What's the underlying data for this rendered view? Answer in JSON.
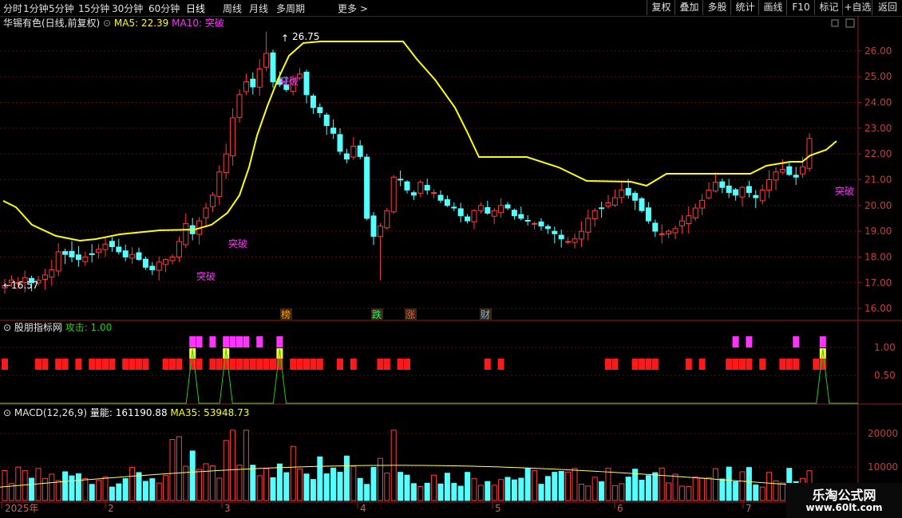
{
  "toolbar": {
    "left": [
      "分时",
      "1分钟",
      "5分钟",
      "15分钟",
      "30分钟",
      "60分钟",
      "日线",
      "周线",
      "月线",
      "多周期",
      "更多"
    ],
    "active": "日线",
    "right": [
      "复权",
      "叠加",
      "多股",
      "统计",
      "画线",
      "F10",
      "标记",
      "+自选",
      "返回"
    ]
  },
  "main_header": {
    "stock": "华锡有色(日线,前复权)",
    "ma5": "MA5: 22.39",
    "ma10": "MA10: 突破"
  },
  "ind_header": {
    "name": "股朋指标网",
    "attack": "攻击: 1.00"
  },
  "vol_header": {
    "name": "MACD(12,26,9)",
    "vol": "量能: 161190.88",
    "ma35": "MA35: 53948.73"
  },
  "price_axis_labels": [
    "26.00",
    "25.00",
    "24.00",
    "23.00",
    "22.00",
    "21.00",
    "20.00",
    "19.00",
    "18.00",
    "17.00",
    "16.00"
  ],
  "ind_axis_labels": [
    "1.00",
    "0.50"
  ],
  "vol_axis_labels": [
    "20000",
    "10000"
  ],
  "date_labels": [
    "2025年",
    "2",
    "3",
    "4",
    "5",
    "6",
    "7"
  ],
  "annotations": {
    "high": "26.75",
    "low": "16.57",
    "breakout": "突破",
    "events": [
      "榜",
      "跌",
      "涨",
      "财"
    ]
  },
  "watermark": {
    "line1": "乐淘公式网",
    "line2": "www.60lt.com"
  },
  "colors": {
    "up": "#ff3c3c",
    "down": "#54ffff",
    "ma": "#ffff00",
    "magenta": "#ff33ff",
    "green": "#22cc22"
  },
  "chart_data": {
    "type": "candlestick",
    "ylim": [
      15.6,
      26.8
    ],
    "close_seed": [
      16.9,
      17.1,
      17.0,
      17.2,
      17.0,
      17.1,
      17.3,
      17.5,
      18.2,
      18.1,
      18.0,
      17.9,
      18.0,
      18.1,
      18.3,
      18.5,
      18.4,
      18.2,
      18.0,
      18.1,
      17.9,
      17.6,
      17.5,
      17.8,
      17.9,
      18.0,
      18.6,
      19.3,
      18.9,
      19.4,
      19.9,
      20.4,
      21.3,
      22.0,
      23.4,
      24.3,
      24.8,
      24.6,
      25.3,
      25.9,
      24.8,
      24.7,
      24.5,
      24.9,
      25.1,
      24.3,
      23.8,
      23.6,
      23.1,
      22.8,
      22.1,
      21.8,
      22.3,
      21.9,
      19.5,
      18.8,
      19.2,
      19.8,
      21.1,
      21.0,
      20.6,
      20.4,
      20.9,
      20.6,
      20.5,
      20.2,
      20.0,
      19.9,
      19.6,
      19.4,
      19.8,
      20.0,
      19.7,
      19.8,
      20.0,
      19.9,
      19.6,
      19.5,
      19.4,
      19.3,
      19.2,
      19.1,
      18.9,
      18.7,
      18.6,
      18.7,
      19.0,
      19.5,
      19.8,
      19.9,
      20.1,
      20.3,
      20.6,
      20.4,
      20.2,
      19.8,
      19.4,
      19.0,
      18.9,
      19.0,
      19.1,
      19.4,
      19.6,
      19.9,
      20.2,
      20.6,
      20.9,
      20.7,
      20.5,
      20.4,
      20.7,
      20.5,
      20.3,
      20.6,
      21.0,
      21.3,
      21.4,
      21.2,
      21.1,
      21.5,
      22.6
    ]
  }
}
